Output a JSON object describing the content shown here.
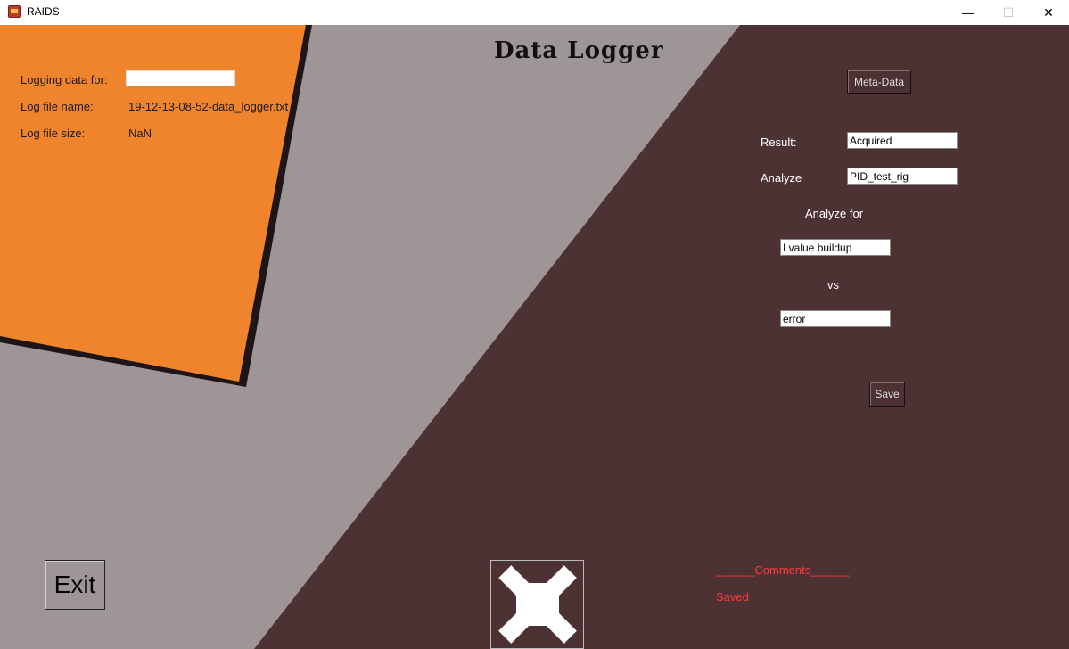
{
  "window": {
    "title": "RAIDS",
    "minimize_glyph": "—",
    "maximize_glyph": "☐",
    "close_glyph": "✕"
  },
  "heading": "Data Logger",
  "log_panel": {
    "logging_label": "Logging data for:",
    "logging_value": "",
    "filename_label": "Log file name:",
    "filename_value": "19-12-13-08-52-data_logger.txt",
    "filesize_label": "Log file size:",
    "filesize_value": "NaN"
  },
  "meta_panel": {
    "metadata_button": "Meta-Data",
    "result_label": "Result:",
    "result_value": "Acquired",
    "analyze_label": "Analyze",
    "analyze_value": "PID_test_rig",
    "analyze_for_label": "Analyze for",
    "analyze_for_value1": "I value buildup",
    "vs_label": "vs",
    "analyze_for_value2": "error",
    "save_button": "Save"
  },
  "exit_button": "Exit",
  "comments": {
    "header": "______Comments______",
    "status": "Saved"
  },
  "colors": {
    "orange": "#f0842c",
    "gray": "#9e9696",
    "dark": "#4d3234",
    "accent_red": "#ff3b3b"
  },
  "icons": {
    "app": "app-icon",
    "logo": "x-logo-icon"
  }
}
